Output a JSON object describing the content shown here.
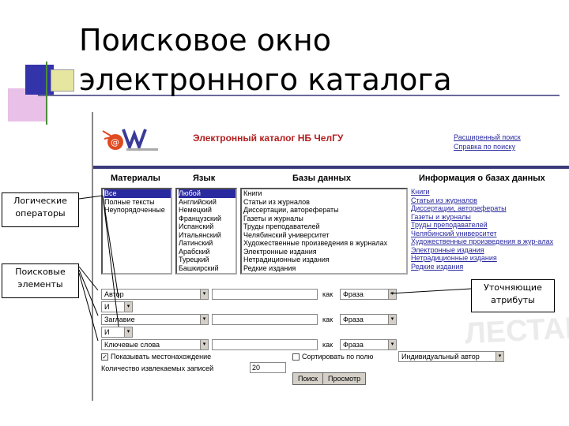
{
  "slide": {
    "title_line1": "Поисковое окно",
    "title_line2": "электронного каталога"
  },
  "catalog": {
    "title": "Электронный каталог НБ ЧелГУ",
    "top_links": [
      "Расширенный поиск",
      "Справка по поиску"
    ],
    "headers": {
      "materials": "Материалы",
      "language": "Язык",
      "databases": "Базы данных",
      "info": "Информация о базах данных"
    },
    "materials_items": [
      "Все",
      "Полные тексты",
      "Неупорядоченные"
    ],
    "language_items": [
      "Любой",
      "Английский",
      "Немецкий",
      "Французский",
      "Испанский",
      "Итальянский",
      "Латинский",
      "Арабский",
      "Турецкий",
      "Башкирский"
    ],
    "database_items": [
      "Книги",
      "Статьи из журналов",
      "Диссертации, авторефераты",
      "Газеты и журналы",
      "Труды преподавателей",
      "Челябинский университет",
      "Художественные произведения в журналах",
      "Электронные издания",
      "Нетрадиционные издания",
      "Редкие издания"
    ],
    "info_items": [
      "Книги",
      "Статьи из журналов",
      "Диссертации, авторефераты",
      "Газеты и журналы",
      "Труды преподавателей",
      "Челябинский университет",
      "Художественные произведения в жур-алах",
      "Электронные издания",
      "Нетрадиционные издания",
      "Редкие издания"
    ],
    "search_rows": [
      {
        "field": "Автор",
        "kak": "как",
        "attr": "Фраза"
      },
      {
        "field": "Заглавие",
        "kak": "как",
        "attr": "Фраза"
      },
      {
        "field": "Ключевые слова",
        "kak": "как",
        "attr": "Фраза"
      }
    ],
    "operators": [
      "И",
      "И"
    ],
    "show_location": "Показывать местонахождение",
    "sort_label": "Сортировать по полю",
    "sort_value": "Индивидуальный автор",
    "count_label": "Количество извлекаемых записей",
    "count_value": "20",
    "search_button": "Поиск",
    "browse_button": "Просмотр",
    "watermark": "ЛЕСТАВАЛ"
  },
  "callouts": {
    "logic": "Логические операторы",
    "search": "Поисковые элементы",
    "attr": "Уточняющие атрибуты"
  },
  "colors": {
    "link": "#2a2aa0",
    "title_red": "#b32020",
    "divider": "#3a3a7a"
  }
}
